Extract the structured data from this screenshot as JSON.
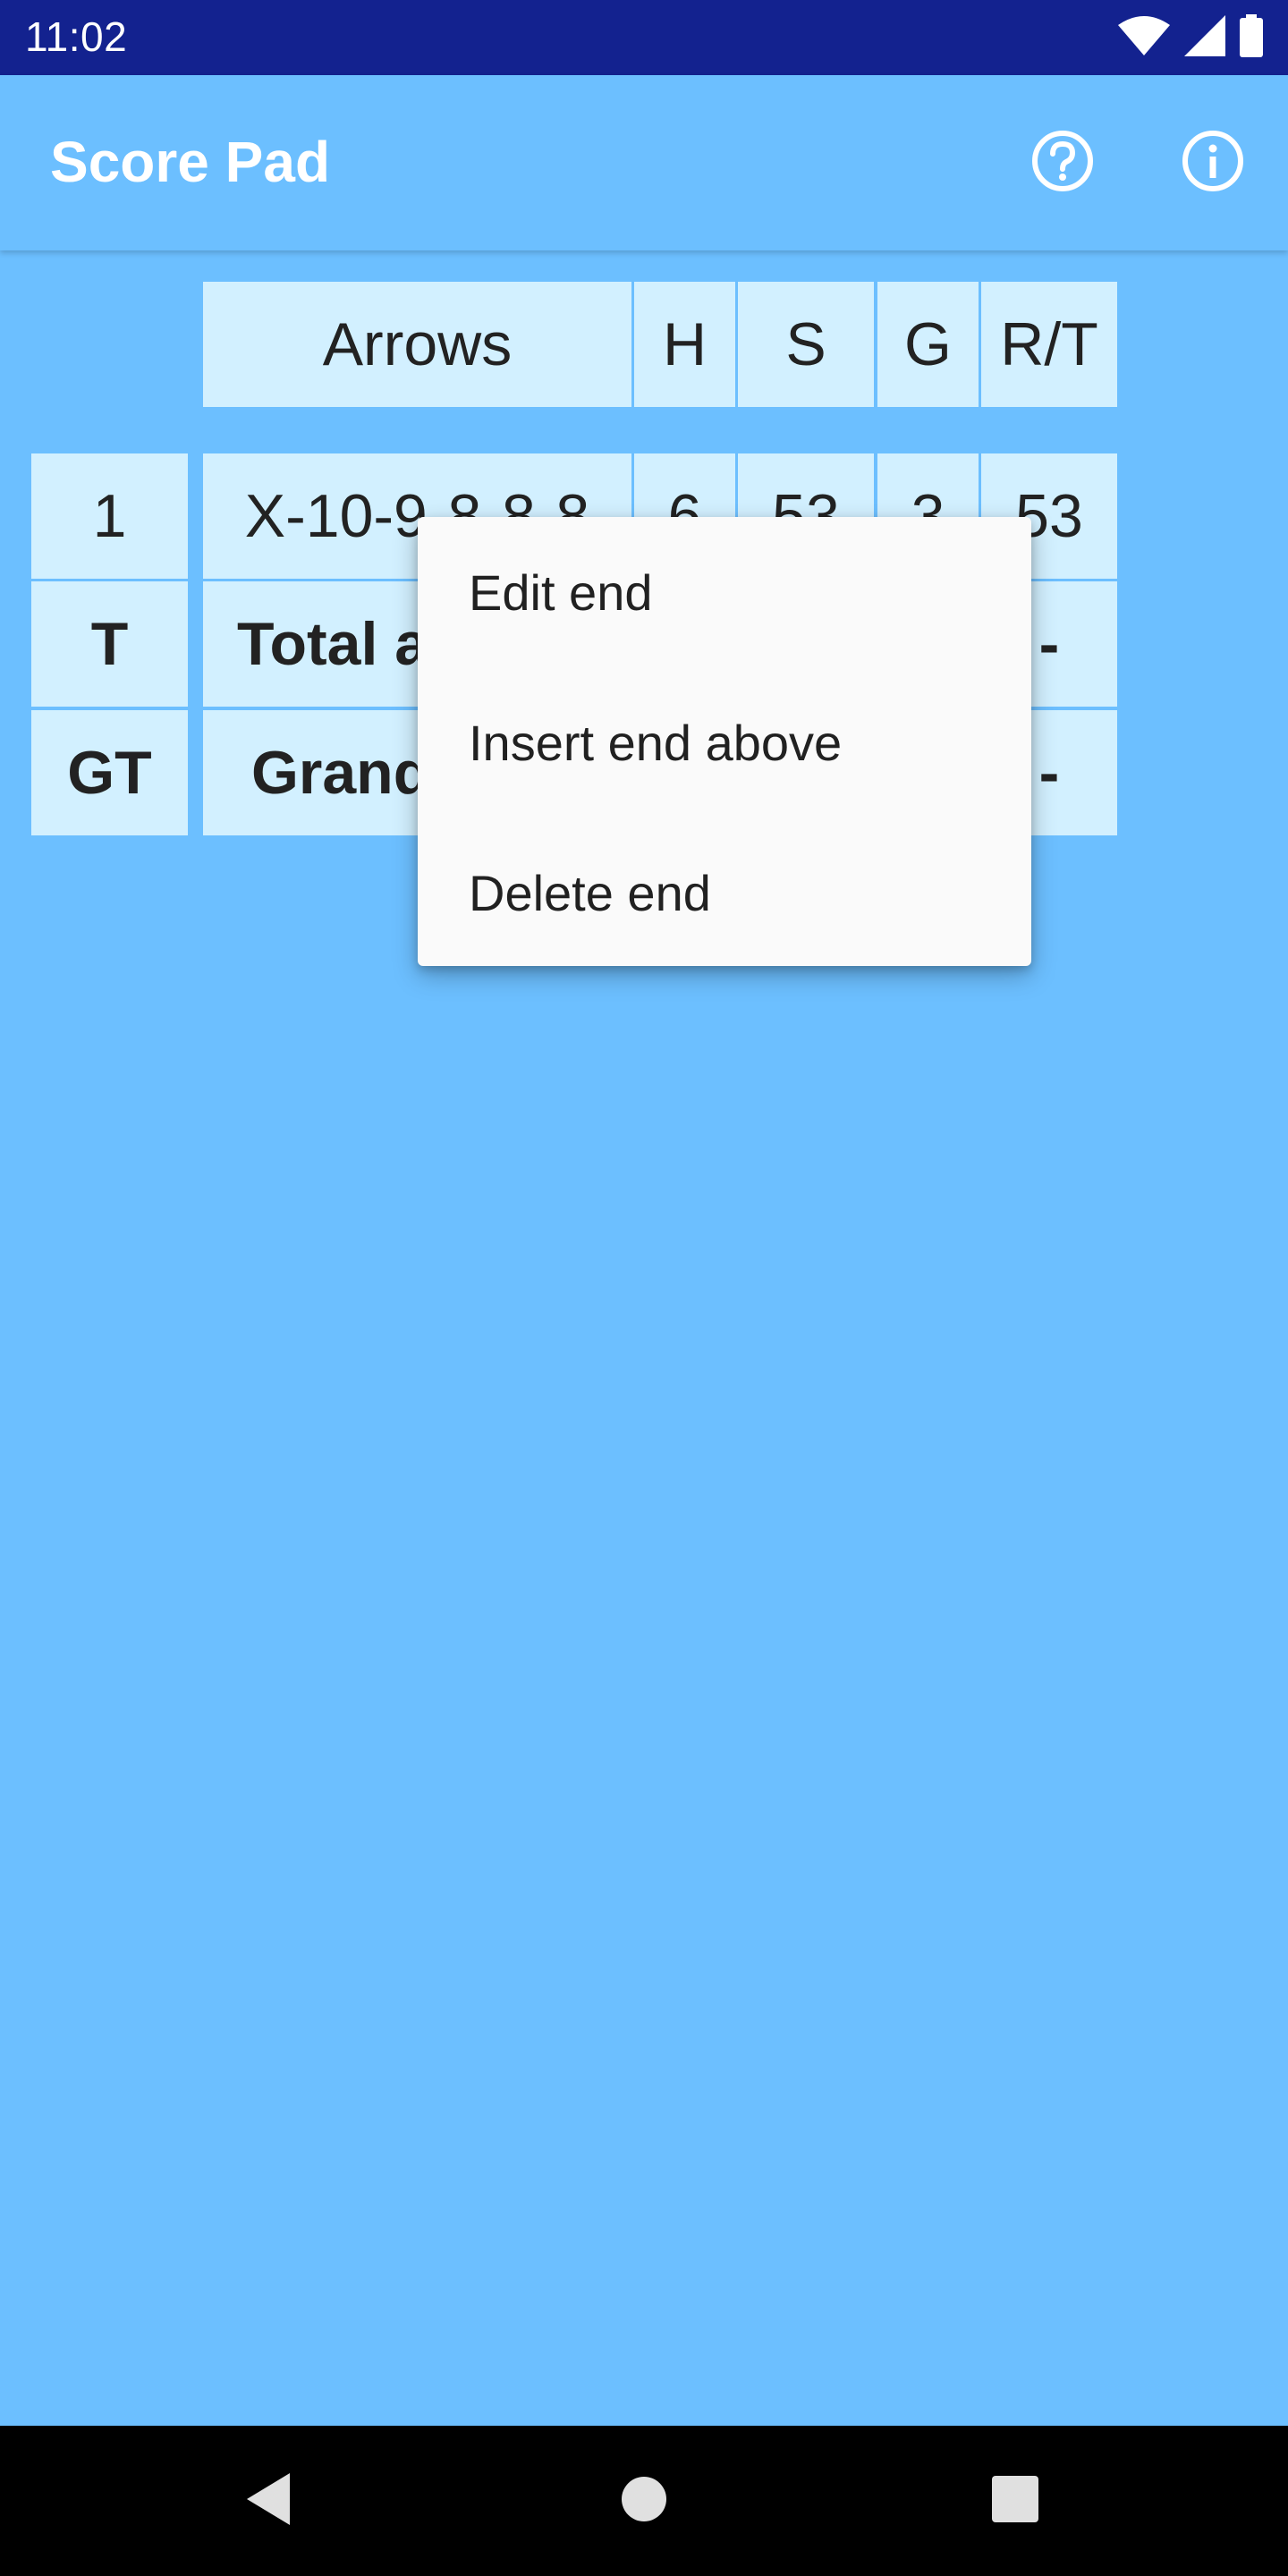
{
  "status_bar": {
    "time": "11:02",
    "icons": [
      "wifi-icon",
      "signal-icon",
      "battery-icon"
    ]
  },
  "app_bar": {
    "title": "Score Pad",
    "actions": [
      "help-icon",
      "info-icon"
    ]
  },
  "table": {
    "headers": [
      "Arrows",
      "H",
      "S",
      "G",
      "R/T"
    ],
    "rows": [
      {
        "label": "1",
        "arrows": "X-10-9-8-8-8",
        "h": "6",
        "s": "53",
        "g": "3",
        "rt": "53"
      },
      {
        "label": "T",
        "arrows": "Total at",
        "rt": "-"
      },
      {
        "label": "GT",
        "arrows": "Grand",
        "rt": "-"
      }
    ]
  },
  "context_menu": {
    "items": [
      "Edit end",
      "Insert end above",
      "Delete end"
    ]
  },
  "colors": {
    "status_bar": "#13228F",
    "background": "#6CBFFF",
    "cell": "#D2F0FF",
    "menu": "#FAFAFA"
  }
}
